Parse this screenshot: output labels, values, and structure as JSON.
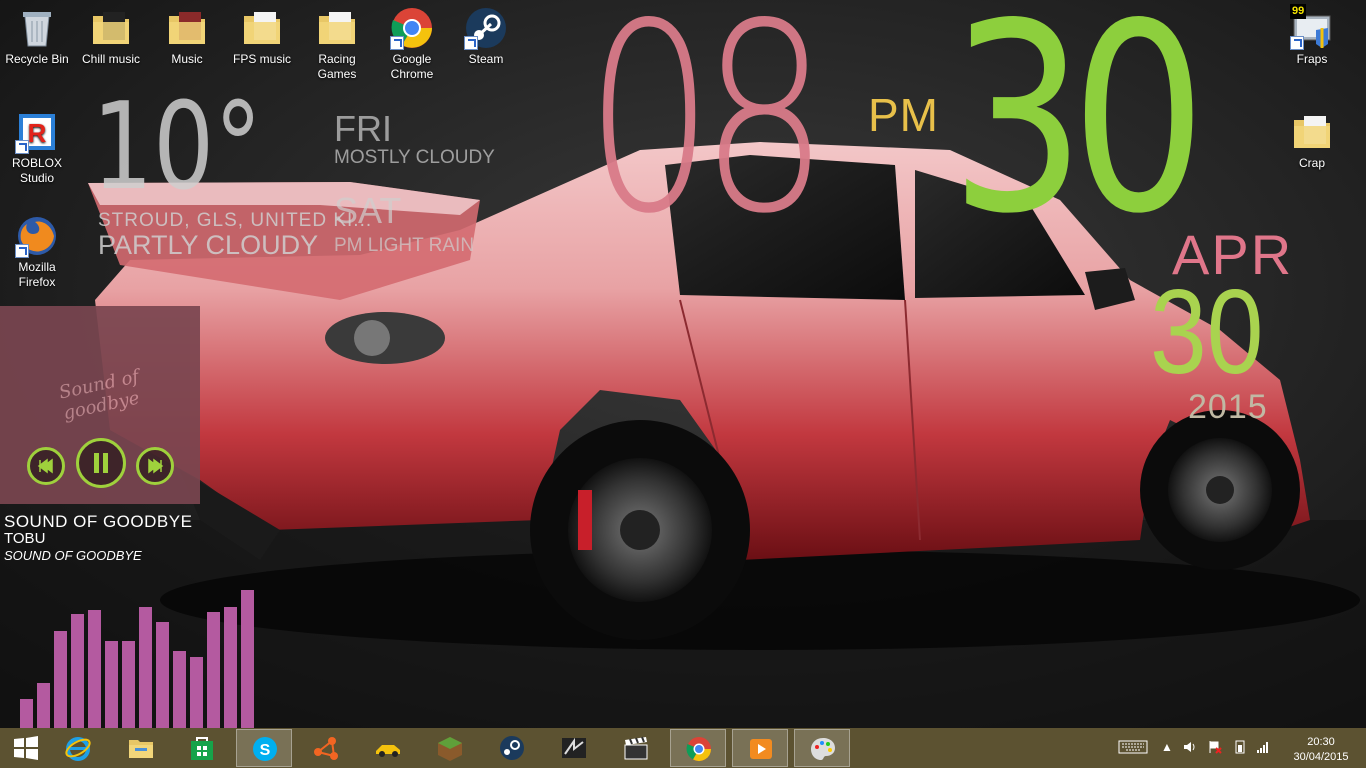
{
  "desktop": {
    "icons": [
      {
        "label": "Recycle Bin"
      },
      {
        "label": "Chill music"
      },
      {
        "label": "Music"
      },
      {
        "label": "FPS music"
      },
      {
        "label": "Racing Games"
      },
      {
        "label": "Google Chrome"
      },
      {
        "label": "Steam"
      },
      {
        "label": "ROBLOX Studio"
      },
      {
        "label": "Mozilla Firefox"
      },
      {
        "label": "Fraps"
      },
      {
        "label": "Crap"
      }
    ]
  },
  "fraps_badge": "99",
  "clock": {
    "hour": "08",
    "minute": "30",
    "ampm": "PM",
    "month": "APR",
    "day": "30",
    "year": "2015",
    "colors": {
      "hour": "#d97b89",
      "minute": "#8dcf3d",
      "ampm": "#e8c04a"
    }
  },
  "weather": {
    "temp": "10°",
    "location": "STROUD, GLS, UNITED KI...",
    "condition": "PARTLY CLOUDY",
    "forecast": [
      {
        "day": "FRI",
        "condition": "MOSTLY CLOUDY"
      },
      {
        "day": "SAT",
        "condition": "PM LIGHT RAIN"
      }
    ]
  },
  "player": {
    "art_text": "Sound of goodbye",
    "title": "SOUND OF GOODBYE",
    "artist": "TOBU",
    "album": "SOUND OF GOODBYE",
    "accent": "#9fd13c"
  },
  "visualizer": {
    "levels": [
      0.17,
      0.27,
      0.58,
      0.68,
      0.7,
      0.52,
      0.52,
      0.72,
      0.63,
      0.46,
      0.42,
      0.69,
      0.72,
      0.82
    ],
    "color": "#b45aa0"
  },
  "taskbar": {
    "items": [
      {
        "icon": "windows-start-icon"
      },
      {
        "icon": "internet-explorer-icon"
      },
      {
        "icon": "file-explorer-icon"
      },
      {
        "icon": "windows-store-icon"
      },
      {
        "icon": "skype-icon"
      },
      {
        "icon": "origin-share-icon"
      },
      {
        "icon": "racing-car-icon"
      },
      {
        "icon": "minecraft-icon"
      },
      {
        "icon": "steam-icon"
      },
      {
        "icon": "need-for-speed-icon"
      },
      {
        "icon": "video-clapper-icon"
      },
      {
        "icon": "chrome-icon"
      },
      {
        "icon": "media-player-icon"
      },
      {
        "icon": "paint-icon"
      }
    ],
    "tray": {
      "time": "20:30",
      "date": "30/04/2015"
    }
  }
}
